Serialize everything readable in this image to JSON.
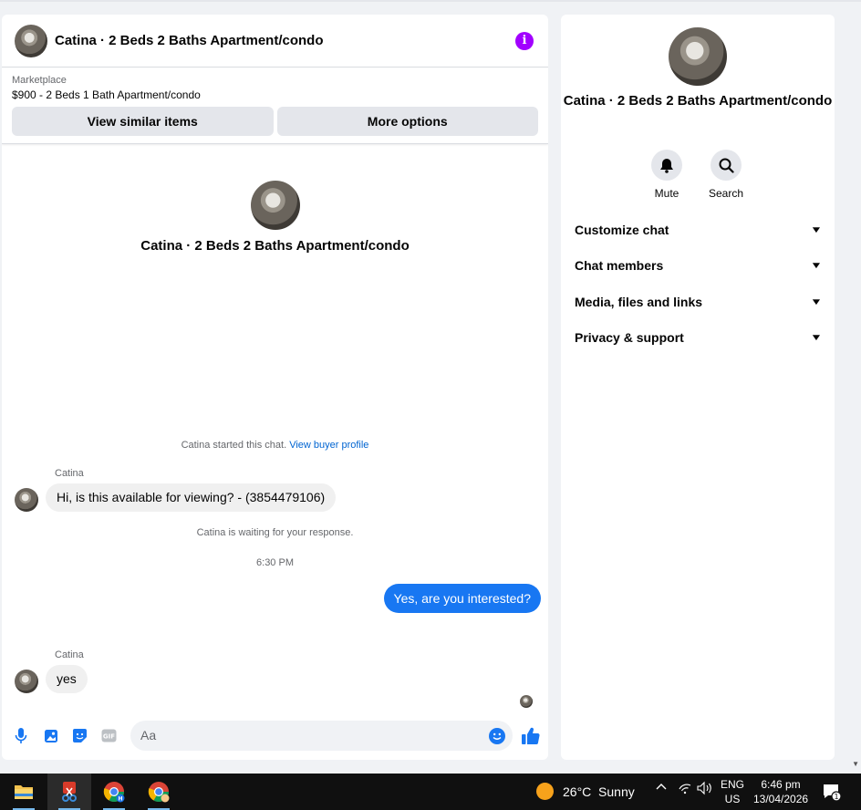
{
  "chat": {
    "title": "Catina · 2 Beds 2 Baths Apartment/condo",
    "marketplace_label": "Marketplace",
    "listing": "$900 - 2 Beds 1 Bath Apartment/condo",
    "view_similar_label": "View similar items",
    "more_options_label": "More options",
    "intro_title": "Catina · 2 Beds 2 Baths Apartment/condo",
    "started_text": "Catina started this chat.",
    "view_buyer_profile": "View buyer profile",
    "messages": [
      {
        "sender": "Catina",
        "text": "Hi, is this available for viewing? - (3854479106)"
      },
      {
        "system": "Catina is waiting for your response."
      },
      {
        "time": "6:30 PM"
      },
      {
        "text": "Yes, are you interested?"
      },
      {
        "sender": "Catina",
        "text": "yes"
      }
    ],
    "composer_placeholder": "Aa"
  },
  "side": {
    "title": "Catina · 2 Beds 2 Baths Apartment/condo",
    "mute_label": "Mute",
    "search_label": "Search",
    "sections": [
      "Customize chat",
      "Chat members",
      "Media, files and links",
      "Privacy & support"
    ]
  },
  "taskbar": {
    "weather": "26°C  Sunny",
    "lang_top": "ENG",
    "lang_bottom": "US",
    "time": "6:46 pm",
    "date": "13/04/2026",
    "notif_count": "1"
  },
  "colors": {
    "accent": "#1877f2",
    "info": "#a200ff",
    "link": "#0064d1"
  }
}
